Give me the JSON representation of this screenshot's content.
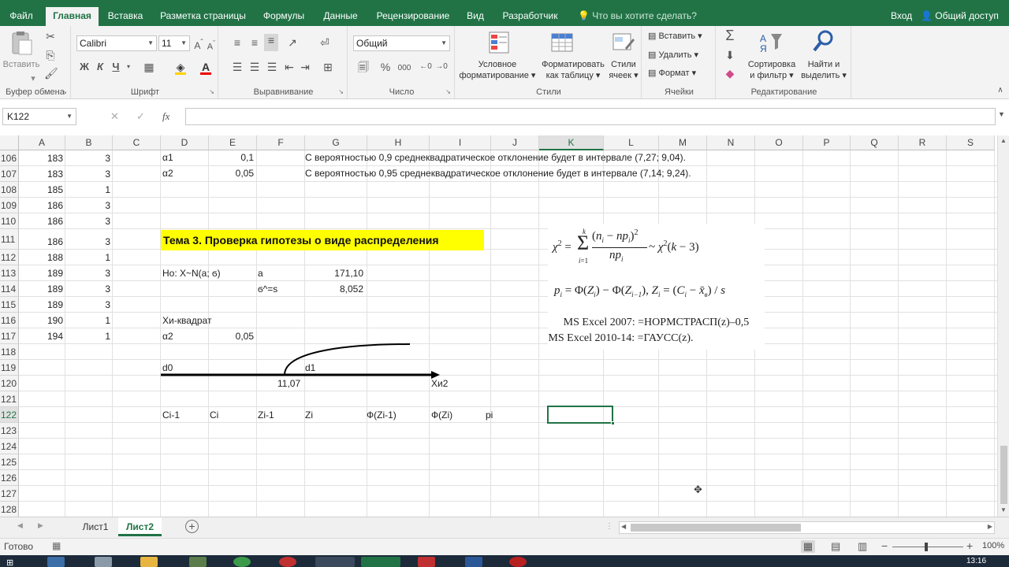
{
  "ribbon_tabs": [
    "Файл",
    "Главная",
    "Вставка",
    "Разметка страницы",
    "Формулы",
    "Данные",
    "Рецензирование",
    "Вид",
    "Разработчик"
  ],
  "tell_me": "Что вы хотите сделать?",
  "sign_in": "Вход",
  "share": "Общий доступ",
  "clipboard": {
    "paste": "Вставить",
    "label": "Буфер обмена"
  },
  "font": {
    "name": "Calibri",
    "size": "11",
    "label": "Шрифт",
    "bold": "Ж",
    "italic": "К",
    "underline": "Ч"
  },
  "alignment": {
    "label": "Выравнивание"
  },
  "number": {
    "format": "Общий",
    "label": "Число",
    "percent": "%",
    "thousands": "000"
  },
  "styles": {
    "conditional": [
      "Условное",
      "форматирование"
    ],
    "format_table": [
      "Форматировать",
      "как таблицу"
    ],
    "cell_styles": [
      "Стили",
      "ячеек"
    ],
    "label": "Стили"
  },
  "cells": {
    "insert": "Вставить",
    "delete": "Удалить",
    "format": "Формат",
    "label": "Ячейки"
  },
  "editing": {
    "sort": [
      "Сортировка",
      "и фильтр"
    ],
    "find": [
      "Найти и",
      "выделить"
    ],
    "label": "Редактирование"
  },
  "namebox": "K122",
  "fx": "fx",
  "columns": [
    "A",
    "B",
    "C",
    "D",
    "E",
    "F",
    "G",
    "H",
    "I",
    "J",
    "K",
    "L",
    "M",
    "N",
    "O",
    "P",
    "Q",
    "R",
    "S"
  ],
  "rows": [
    "106",
    "107",
    "108",
    "109",
    "110",
    "111",
    "112",
    "113",
    "114",
    "115",
    "116",
    "117",
    "118",
    "119",
    "120",
    "121",
    "122",
    "123",
    "124",
    "125",
    "126",
    "127",
    "128"
  ],
  "col_a": [
    "183",
    "183",
    "185",
    "186",
    "186",
    "186",
    "188",
    "189",
    "189",
    "189",
    "190",
    "194"
  ],
  "col_b": [
    "3",
    "3",
    "1",
    "3",
    "3",
    "3",
    "1",
    "3",
    "3",
    "3",
    "1",
    "1"
  ],
  "cells_text": {
    "d106": "α1",
    "e106": "0,1",
    "g106": "С вероятностью 0,9 среднеквадратическое отклонение будет в интервале (7,27; 9,04).",
    "d107": "α2",
    "e107": "0,05",
    "g107": "С вероятностью 0,95 среднеквадратическое отклонение будет в интервале (7,14; 9,24).",
    "theme": "Тема 3. Проверка гипотезы о виде распределения",
    "d113": "Ho: X~N(a; ϭ)",
    "f113": "a",
    "g113": "171,10",
    "f114": "ϭ^=s",
    "g114": "8,052",
    "d116": "Хи-квадрат",
    "d117": "α2",
    "e117": "0,05",
    "d119": "d0",
    "g119": "d1",
    "f120": "11,07",
    "h120": "Хи2",
    "d122": "Ci-1",
    "e122": "Ci",
    "f122": "Zi-1",
    "g122": "Zi",
    "h122": "Ф(Zi-1)",
    "i122": "Ф(Zi)",
    "j122": "pi"
  },
  "formula_image": {
    "ms_2007": "MS Excel 2007: =НОРМСТРАСП(z)–0,5",
    "ms_2010": "MS Excel 2010-14: =ГАУСС(z)."
  },
  "sheets": [
    "Лист1",
    "Лист2"
  ],
  "active_sheet": "Лист2",
  "status": "Готово",
  "zoom": "100%",
  "clock": "13:16",
  "colors": {
    "accent": "#217346",
    "highlight": "#ffff00"
  }
}
